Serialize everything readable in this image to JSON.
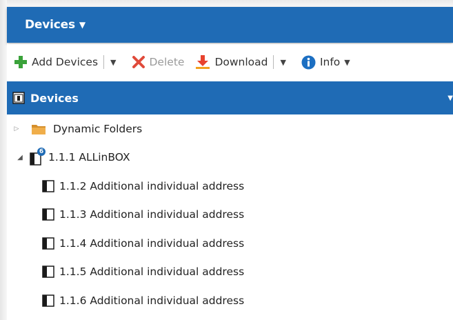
{
  "window": {
    "title": "Devices"
  },
  "toolbar": {
    "add_label": "Add Devices",
    "delete_label": "Delete",
    "download_label": "Download",
    "info_label": "Info"
  },
  "section": {
    "title": "Devices"
  },
  "tree": {
    "dynamic_folders": "Dynamic Folders",
    "main_device": {
      "label": "1.1.1 ALLinBOX",
      "badge": "6"
    },
    "children": [
      {
        "label": "1.1.2 Additional individual address"
      },
      {
        "label": "1.1.3 Additional individual address"
      },
      {
        "label": "1.1.4 Additional individual address"
      },
      {
        "label": "1.1.5 Additional individual address"
      },
      {
        "label": "1.1.6 Additional individual address"
      }
    ]
  },
  "colors": {
    "header_blue": "#1f6bb5",
    "add_green": "#3aa23a",
    "delete_red": "#e04b3b",
    "download_red": "#e8432e",
    "download_orange": "#f2a01e",
    "info_blue": "#1c6fc2",
    "folder_orange": "#e7a23c"
  },
  "icons": {
    "add": "plus-icon",
    "delete": "x-icon",
    "download": "download-arrow-icon",
    "info": "info-circle-icon",
    "folder": "folder-icon",
    "device": "device-icon"
  }
}
